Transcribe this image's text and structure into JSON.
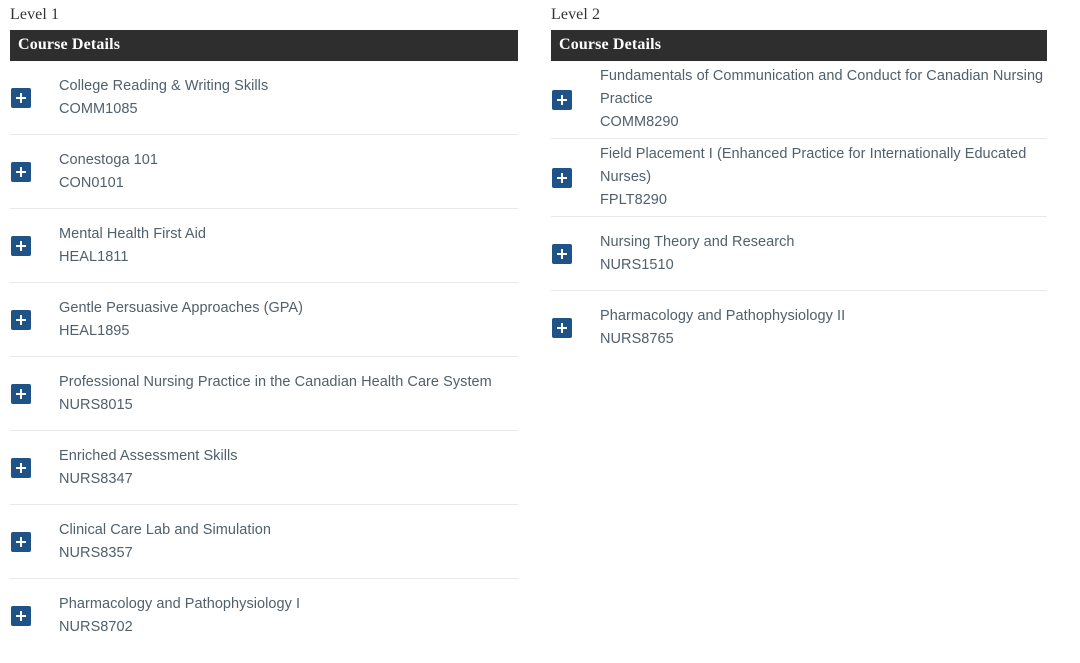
{
  "columns": [
    {
      "level_title": "Level 1",
      "table_header": "Course Details",
      "expand_icon": "plus-icon",
      "courses": [
        {
          "name": "College Reading & Writing Skills",
          "code": "COMM1085"
        },
        {
          "name": "Conestoga 101",
          "code": "CON0101"
        },
        {
          "name": "Mental Health First Aid",
          "code": "HEAL1811"
        },
        {
          "name": "Gentle Persuasive Approaches (GPA)",
          "code": "HEAL1895"
        },
        {
          "name": "Professional Nursing Practice in the Canadian Health Care System",
          "code": "NURS8015"
        },
        {
          "name": "Enriched Assessment Skills",
          "code": "NURS8347"
        },
        {
          "name": "Clinical Care Lab and Simulation",
          "code": "NURS8357"
        },
        {
          "name": "Pharmacology and Pathophysiology I",
          "code": "NURS8702"
        }
      ]
    },
    {
      "level_title": "Level 2",
      "table_header": "Course Details",
      "expand_icon": "plus-icon",
      "courses": [
        {
          "name": "Fundamentals of Communication and Conduct for Canadian Nursing Practice",
          "code": "COMM8290"
        },
        {
          "name": "Field Placement I (Enhanced Practice for Internationally Educated Nurses)",
          "code": "FPLT8290"
        },
        {
          "name": "Nursing Theory and Research",
          "code": "NURS1510"
        },
        {
          "name": "Pharmacology and Pathophysiology II",
          "code": "NURS8765"
        }
      ]
    }
  ],
  "colors": {
    "header_background": "#2e2e2e",
    "header_text": "#ffffff",
    "expand_button": "#1f5287",
    "course_text": "#50606d",
    "divider": "#e8e8e8",
    "page_background": "#ffffff"
  }
}
